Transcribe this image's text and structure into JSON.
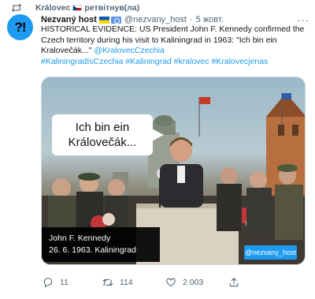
{
  "retweet": {
    "user": "Královec",
    "label": "ретвітнув(ла)"
  },
  "tweet": {
    "avatar_text": "?!",
    "author_name": "Nezvaný host",
    "author_handle": "@nezvany_host",
    "separator": "·",
    "date": "5 жовт.",
    "more_label": "···",
    "text_lines": [
      "HISTORICAL EVIDENCE: US President John F. Kennedy confirmed the",
      "Czech territory during his visit to Kaliningrad in 1963: \"Ich bin ein",
      "Kraloveĉák...\""
    ],
    "mention": "@KralovecCzechia",
    "hashtags": "#KaliningradIsCzechia #Kaliningrad #kralovec #Kralovecjenas"
  },
  "media": {
    "bubble_line1": "Ich bin ein",
    "bubble_line2": "Královečák...",
    "caption_line1": "John F. Kennedy",
    "caption_line2": "26. 6. 1963. Kaliningrad",
    "watermark": "@nezvany_host"
  },
  "actions": {
    "reply_count": "11",
    "retweet_count": "114",
    "like_count": "2 003"
  },
  "colors": {
    "accent": "#1d9bf0",
    "text": "#0f1419",
    "muted": "#536471"
  }
}
